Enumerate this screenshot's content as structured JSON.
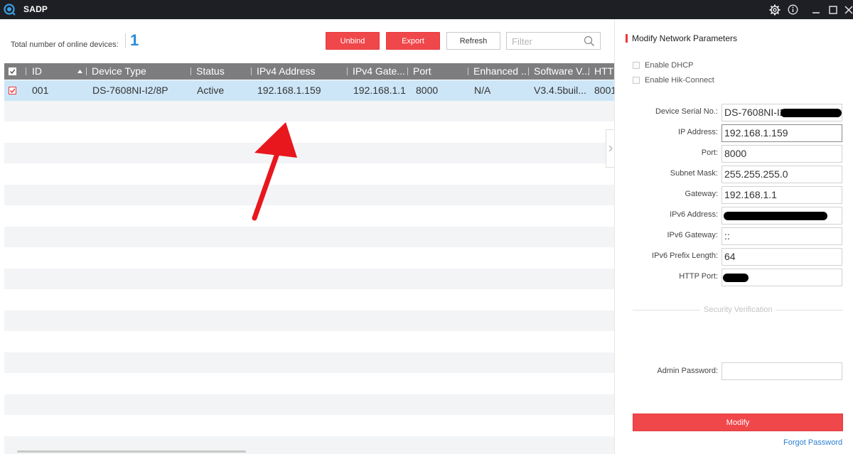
{
  "window": {
    "title": "SADP",
    "icons": [
      "settings-icon",
      "info-icon",
      "minimize-icon",
      "maximize-icon",
      "close-icon"
    ]
  },
  "toolbar": {
    "total_label": "Total number of online devices:",
    "total_count": "1",
    "unbind_label": "Unbind",
    "export_label": "Export",
    "refresh_label": "Refresh",
    "filter_placeholder": "Filter"
  },
  "table": {
    "headers": [
      "ID",
      "Device Type",
      "Status",
      "IPv4 Address",
      "IPv4 Gate...",
      "Port",
      "Enhanced ...",
      "Software V...",
      "HTTP"
    ],
    "rows": [
      {
        "id": "001",
        "device_type": "DS-7608NI-I2/8P",
        "status": "Active",
        "ipv4": "192.168.1.159",
        "gateway": "192.168.1.1",
        "port": "8000",
        "enhanced": "N/A",
        "software": "V3.4.5buil...",
        "http": "8001"
      }
    ]
  },
  "panel": {
    "title": "Modify Network Parameters",
    "enable_dhcp": "Enable DHCP",
    "enable_hik": "Enable Hik-Connect",
    "fields": {
      "serial_label": "Device Serial No.:",
      "serial_value": "DS-7608NI-I2",
      "ip_label": "IP Address:",
      "ip_value": "192.168.1.159",
      "port_label": "Port:",
      "port_value": "8000",
      "mask_label": "Subnet Mask:",
      "mask_value": "255.255.255.0",
      "gateway_label": "Gateway:",
      "gateway_value": "192.168.1.1",
      "ipv6_label": "IPv6 Address:",
      "ipv6_gw_label": "IPv6 Gateway:",
      "ipv6_gw_value": "::",
      "ipv6_prefix_label": "IPv6 Prefix Length:",
      "ipv6_prefix_value": "64",
      "http_label": "HTTP Port:"
    },
    "security_verification": "Security Verification",
    "admin_password_label": "Admin Password:",
    "modify_label": "Modify",
    "forgot_label": "Forgot Password"
  },
  "colors": {
    "accent_red": "#f0474b",
    "link_blue": "#2b7fd0",
    "count_blue": "#2b8ad8",
    "selected_row": "#cde6f7",
    "header_gray": "#7d7d7f",
    "titlebar": "#1d1f24"
  }
}
